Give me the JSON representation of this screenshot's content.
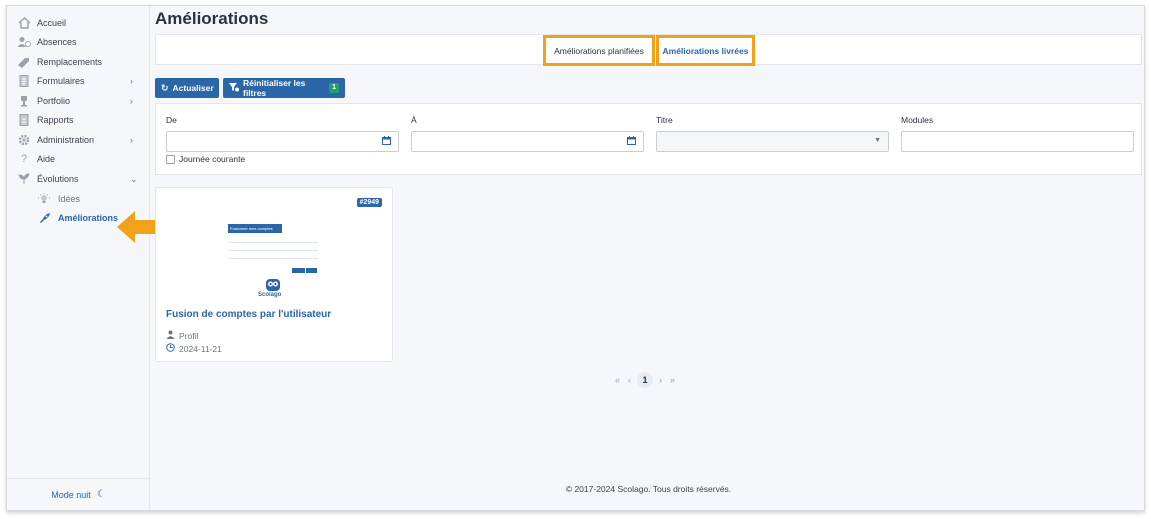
{
  "sidebar": {
    "items": [
      {
        "label": "Accueil",
        "icon": "home-icon"
      },
      {
        "label": "Absences",
        "icon": "user-clock-icon"
      },
      {
        "label": "Remplacements",
        "icon": "swap-icon"
      },
      {
        "label": "Formulaires",
        "icon": "form-icon",
        "chevron": "›"
      },
      {
        "label": "Portfolio",
        "icon": "trophy-icon",
        "chevron": "›"
      },
      {
        "label": "Rapports",
        "icon": "report-icon"
      },
      {
        "label": "Administration",
        "icon": "gear-icon",
        "chevron": "›"
      },
      {
        "label": "Aide",
        "icon": "help-icon"
      },
      {
        "label": "Évolutions",
        "icon": "sprout-icon",
        "chevron": "⌄"
      }
    ],
    "sub_items": [
      {
        "label": "Idées",
        "icon": "lightbulb-icon"
      },
      {
        "label": "Améliorations",
        "icon": "rocket-icon",
        "active": true
      }
    ],
    "footer": {
      "label": "Mode nuit",
      "icon": "moon-icon"
    }
  },
  "page": {
    "title": "Améliorations"
  },
  "tabs": {
    "planned": "Améliorations planifiées",
    "delivered": "Améliorations livrées",
    "active": "delivered"
  },
  "toolbar": {
    "refresh_label": "Actualiser",
    "reset_label": "Réinitialiser les filtres",
    "reset_count": "1"
  },
  "filters": {
    "from_label": "De",
    "to_label": "À",
    "title_label": "Titre",
    "modules_label": "Modules",
    "from_value": "",
    "to_value": "",
    "title_value": "",
    "modules_value": "",
    "today_label": "Journée courante",
    "today_checked": false
  },
  "card": {
    "badge": "#2949",
    "title": "Fusion de comptes par l'utilisateur",
    "module": "Profil",
    "date": "2024-11-21",
    "thumbnail": {
      "header": "Fusionner mes comptes",
      "logo": "Scolago"
    }
  },
  "pagination": {
    "first": "«",
    "prev": "‹",
    "current": "1",
    "next": "›",
    "last": "»"
  },
  "footer": {
    "text": "© 2017-2024 Scolago. Tous droits réservés."
  },
  "colors": {
    "accent": "#2a66a8",
    "highlight": "#f2a21a",
    "success": "#22a06b"
  }
}
